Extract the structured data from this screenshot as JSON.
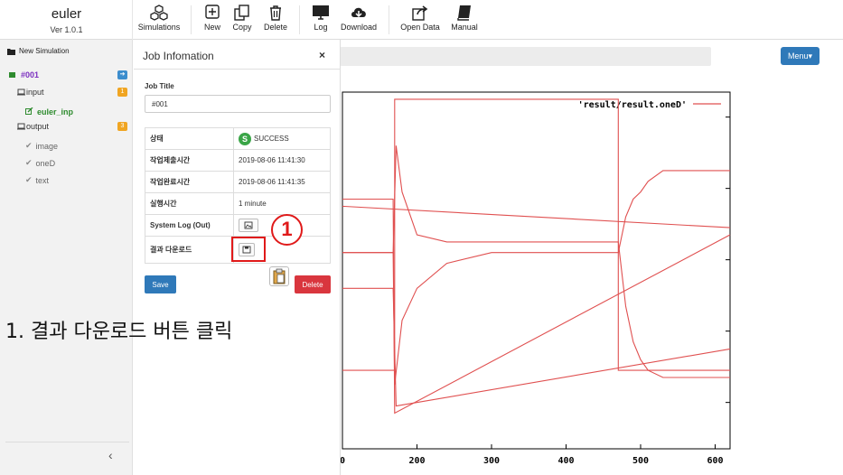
{
  "app": {
    "name": "euler",
    "version": "Ver 1.0.1"
  },
  "toolbar": [
    {
      "label": "Simulations",
      "icon": "cubes-icon"
    },
    {
      "label": "New",
      "icon": "plus-square-icon"
    },
    {
      "label": "Copy",
      "icon": "copy-icon"
    },
    {
      "label": "Delete",
      "icon": "trash-icon"
    },
    {
      "label": "Log",
      "icon": "monitor-icon"
    },
    {
      "label": "Download",
      "icon": "cloud-download-icon"
    },
    {
      "label": "Open Data",
      "icon": "share-icon"
    },
    {
      "label": "Manual",
      "icon": "book-icon"
    }
  ],
  "sidebar": {
    "new_simulation": "New Simulation",
    "job": {
      "label": "#001",
      "color": "#7b2fbf"
    },
    "input": {
      "label": "input",
      "badge": "1"
    },
    "input_file": {
      "label": "euler_inp",
      "color": "#2e8b2e"
    },
    "output": {
      "label": "output",
      "badge": "3"
    },
    "output_items": [
      "image",
      "oneD",
      "text"
    ],
    "collapse_icon": "‹"
  },
  "header": {
    "menu_label": "Menu▾"
  },
  "panel": {
    "title": "Job Infomation",
    "close": "×",
    "job_title_label": "Job Title",
    "job_title_value": "#001",
    "rows": [
      {
        "key": "상태",
        "value": "SUCCESS"
      },
      {
        "key": "작업제출시간",
        "value": "2019-08-06 11:41:30"
      },
      {
        "key": "작업완료시간",
        "value": "2019-08-06 11:41:35"
      },
      {
        "key": "실행시간",
        "value": "1 minute"
      },
      {
        "key": "System Log (Out)",
        "value": ""
      },
      {
        "key": "결과 다운로드",
        "value": ""
      }
    ],
    "status_letter": "S",
    "save_label": "Save",
    "delete_label": "Delete"
  },
  "annotation": {
    "step_number": "1",
    "instruction": "1. 결과 다운로드 버튼 클릭"
  },
  "chart_data": {
    "type": "line",
    "legend": [
      "'result/result.oneD'"
    ],
    "line_color": "#e05050",
    "xlim": [
      0,
      620
    ],
    "x_ticks": [
      200,
      300,
      400,
      500,
      600
    ],
    "x_tick_labels_visible": [
      "0",
      "200",
      "300",
      "400",
      "500",
      "600"
    ],
    "series": [
      {
        "x": [
          0,
          170,
          170,
          470,
          470,
          620
        ],
        "y": [
          0.22,
          0.22,
          0.98,
          0.98,
          0.22,
          0.22
        ]
      },
      {
        "x": [
          0,
          620
        ],
        "y": [
          0.68,
          0.62
        ]
      },
      {
        "x": [
          0,
          168,
          170,
          180,
          200,
          240,
          300,
          470,
          480,
          490,
          500,
          510,
          530,
          560,
          620
        ],
        "y": [
          0.55,
          0.55,
          0.18,
          0.36,
          0.45,
          0.52,
          0.55,
          0.55,
          0.65,
          0.7,
          0.72,
          0.75,
          0.78,
          0.78,
          0.78
        ]
      },
      {
        "x": [
          0,
          168,
          172,
          180,
          200,
          240,
          300,
          470,
          480,
          490,
          500,
          510,
          530,
          560,
          620
        ],
        "y": [
          0.55,
          0.55,
          0.85,
          0.72,
          0.6,
          0.58,
          0.58,
          0.58,
          0.4,
          0.3,
          0.25,
          0.22,
          0.2,
          0.2,
          0.2
        ]
      },
      {
        "x": [
          0,
          168,
          172,
          620
        ],
        "y": [
          0.45,
          0.45,
          0.12,
          0.28
        ]
      },
      {
        "x": [
          0,
          168,
          170,
          620
        ],
        "y": [
          0.7,
          0.7,
          0.1,
          0.6
        ]
      }
    ]
  }
}
